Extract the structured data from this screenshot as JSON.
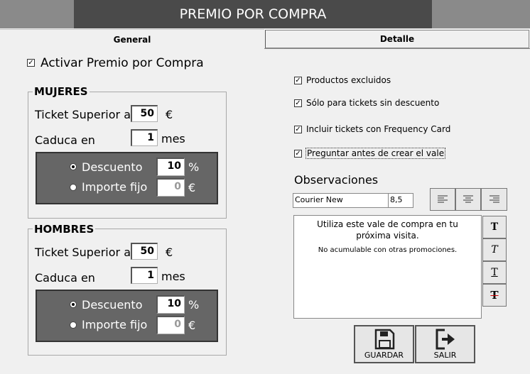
{
  "window": {
    "title": "PREMIO POR COMPRA"
  },
  "tabs": [
    {
      "label": "General"
    },
    {
      "label": "Detalle"
    }
  ],
  "activar": {
    "label": "Activar Premio por Compra",
    "checked": true
  },
  "mujeres": {
    "legend": "MUJERES",
    "ticket_label": "Ticket Superior a",
    "ticket_value": "50",
    "ticket_unit": "€",
    "caduca_label": "Caduca en",
    "caduca_value": "1",
    "caduca_unit": "mes",
    "descuento_label": "Descuento",
    "descuento_value": "10",
    "descuento_unit": "%",
    "importe_label": "Importe fijo",
    "importe_value": "0",
    "importe_unit": "€",
    "selected": "descuento"
  },
  "hombres": {
    "legend": "HOMBRES",
    "ticket_label": "Ticket Superior a",
    "ticket_value": "50",
    "ticket_unit": "€",
    "caduca_label": "Caduca en",
    "caduca_value": "1",
    "caduca_unit": "mes",
    "descuento_label": "Descuento",
    "descuento_value": "10",
    "descuento_unit": "%",
    "importe_label": "Importe fijo",
    "importe_value": "0",
    "importe_unit": "€",
    "selected": "descuento"
  },
  "options": [
    {
      "label": "Productos excluidos",
      "checked": true
    },
    {
      "label": "Sólo para tickets sin descuento",
      "checked": true
    },
    {
      "label": "Incluir tickets con Frequency Card",
      "checked": true
    },
    {
      "label": "Preguntar antes de crear el vale",
      "checked": true
    }
  ],
  "observaciones": {
    "label": "Observaciones",
    "font_name": "Courier New",
    "font_size": "8,5",
    "line1": "Utiliza este vale de compra en tu",
    "line2": "próxima visita.",
    "line3": "No acumulable con otras promociones."
  },
  "buttons": {
    "guardar": "GUARDAR",
    "salir": "SALIR"
  },
  "check_mark": "✓"
}
